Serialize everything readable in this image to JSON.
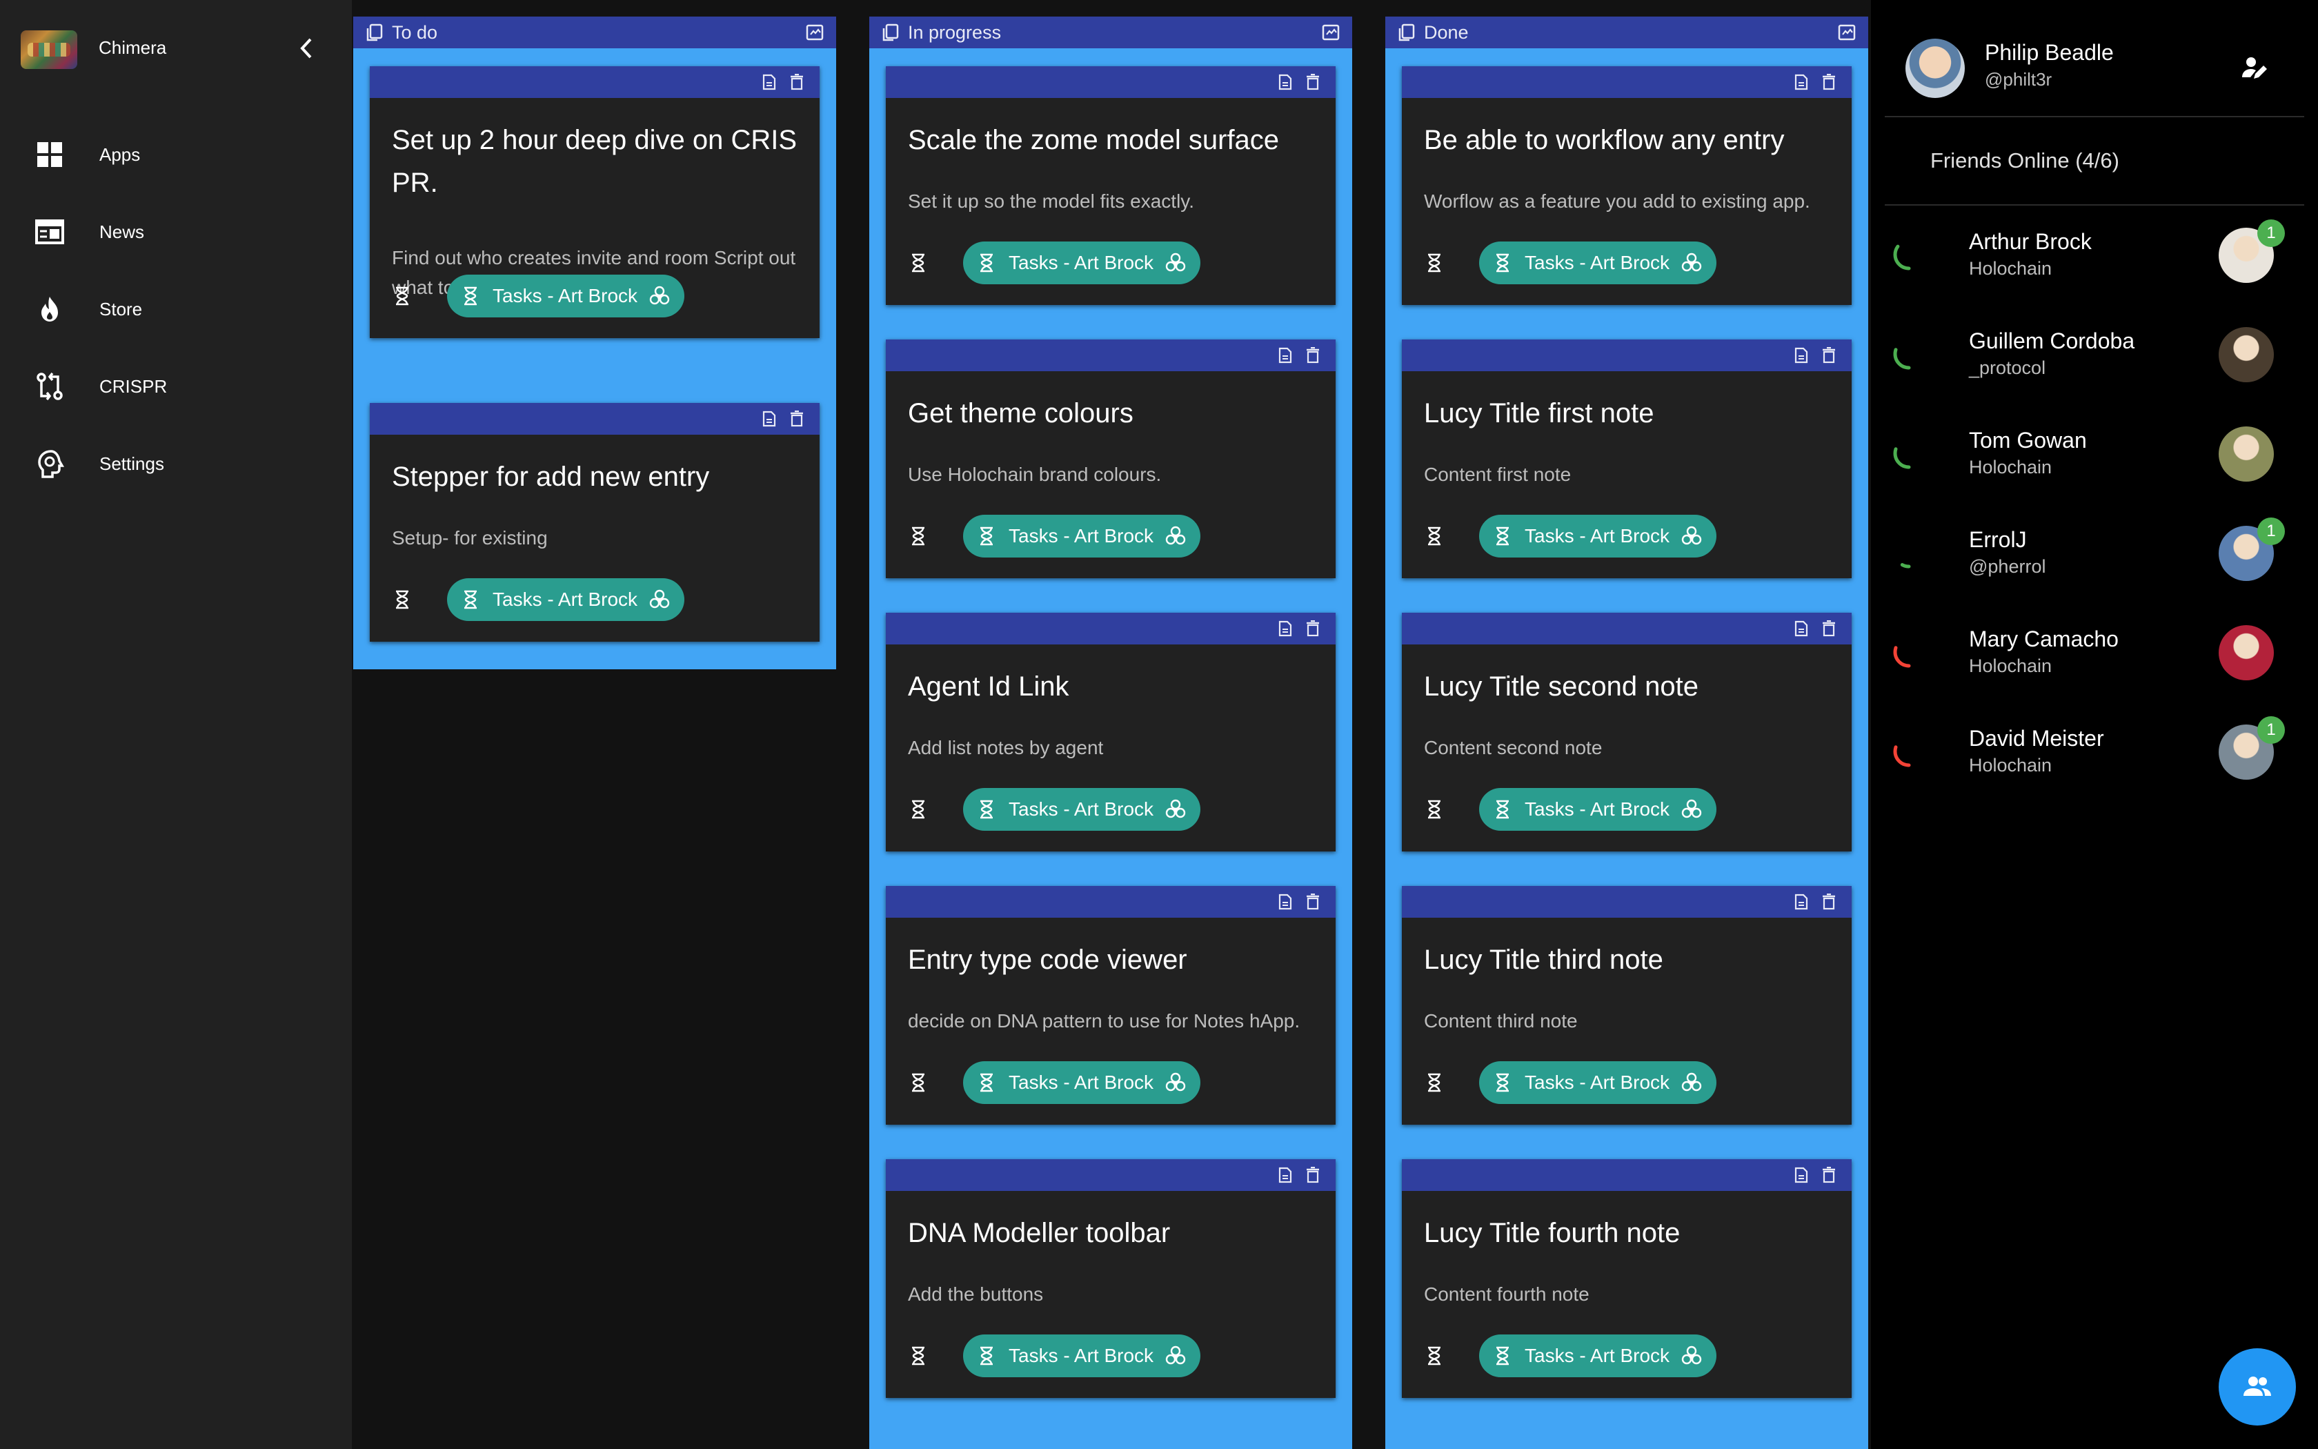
{
  "app": {
    "name": "Chimera"
  },
  "nav": {
    "items": [
      {
        "label": "Apps",
        "icon": "apps-grid-icon"
      },
      {
        "label": "News",
        "icon": "newspaper-icon"
      },
      {
        "label": "Store",
        "icon": "flame-icon"
      },
      {
        "label": "CRISPR",
        "icon": "git-compare-icon"
      },
      {
        "label": "Settings",
        "icon": "psychology-head-icon"
      }
    ]
  },
  "board": {
    "columns": [
      {
        "title": "To do",
        "cards": [
          {
            "title": "Set up 2 hour deep dive on CRIS PR.",
            "description": "Find out who creates invite and room Script out what to deep dive on",
            "tag": "Tasks - Art Brock"
          },
          {
            "title": "Stepper for add new entry",
            "description": "Setup- for existing",
            "tag": "Tasks - Art Brock"
          }
        ]
      },
      {
        "title": "In progress",
        "cards": [
          {
            "title": "Scale the zome model surface",
            "description": "Set it up so the model fits exactly.",
            "tag": "Tasks - Art Brock"
          },
          {
            "title": "Get theme colours",
            "description": "Use Holochain brand colours.",
            "tag": "Tasks - Art Brock"
          },
          {
            "title": "Agent Id Link",
            "description": "Add list notes by agent",
            "tag": "Tasks - Art Brock"
          },
          {
            "title": "Entry type code viewer",
            "description": "decide on DNA pattern to use for Notes hApp.",
            "tag": "Tasks - Art Brock"
          },
          {
            "title": "DNA Modeller toolbar",
            "description": "Add the buttons",
            "tag": "Tasks - Art Brock"
          }
        ]
      },
      {
        "title": "Done",
        "cards": [
          {
            "title": "Be able to workflow any entry",
            "description": "Worflow as a feature you add to existing app.",
            "tag": "Tasks - Art Brock"
          },
          {
            "title": "Lucy Title first note",
            "description": "Content first note",
            "tag": "Tasks - Art Brock"
          },
          {
            "title": "Lucy Title second note",
            "description": "Content second note",
            "tag": "Tasks - Art Brock"
          },
          {
            "title": "Lucy Title third note",
            "description": "Content third note",
            "tag": "Tasks - Art Brock"
          },
          {
            "title": "Lucy Title fourth note",
            "description": "Content fourth note",
            "tag": "Tasks - Art Brock"
          }
        ]
      }
    ]
  },
  "profile": {
    "name": "Philip Beadle",
    "handle": "@philt3r"
  },
  "friends": {
    "heading": "Friends Online (4/6)",
    "list": [
      {
        "name": "Arthur Brock",
        "sub": "Holochain",
        "status": "online",
        "status_color": "#4caf50",
        "progress": 0.35,
        "badge": "1",
        "avatar_color": "#e9e4dc"
      },
      {
        "name": "Guillem Cordoba",
        "sub": "_protocol",
        "status": "online",
        "status_color": "#4caf50",
        "progress": 0.3,
        "badge": "",
        "avatar_color": "#4a3d2f"
      },
      {
        "name": "Tom Gowan",
        "sub": "Holochain",
        "status": "online",
        "status_color": "#4caf50",
        "progress": 0.3,
        "badge": "",
        "avatar_color": "#8a8d5a"
      },
      {
        "name": "ErrolJ",
        "sub": "@pherrol",
        "status": "online",
        "status_color": "#4caf50",
        "progress": 0.08,
        "badge": "1",
        "avatar_color": "#5a7fb0"
      },
      {
        "name": "Mary Camacho",
        "sub": "Holochain",
        "status": "offline",
        "status_color": "#f44336",
        "progress": 0.3,
        "badge": "",
        "avatar_color": "#b3223a"
      },
      {
        "name": "David Meister",
        "sub": "Holochain",
        "status": "offline",
        "status_color": "#f44336",
        "progress": 0.3,
        "badge": "1",
        "avatar_color": "#7b8a96"
      }
    ]
  },
  "colors": {
    "column_bg": "#42a5f5",
    "header_bar": "#303f9f",
    "chip": "#2a9d8f",
    "fab": "#2196f3"
  }
}
